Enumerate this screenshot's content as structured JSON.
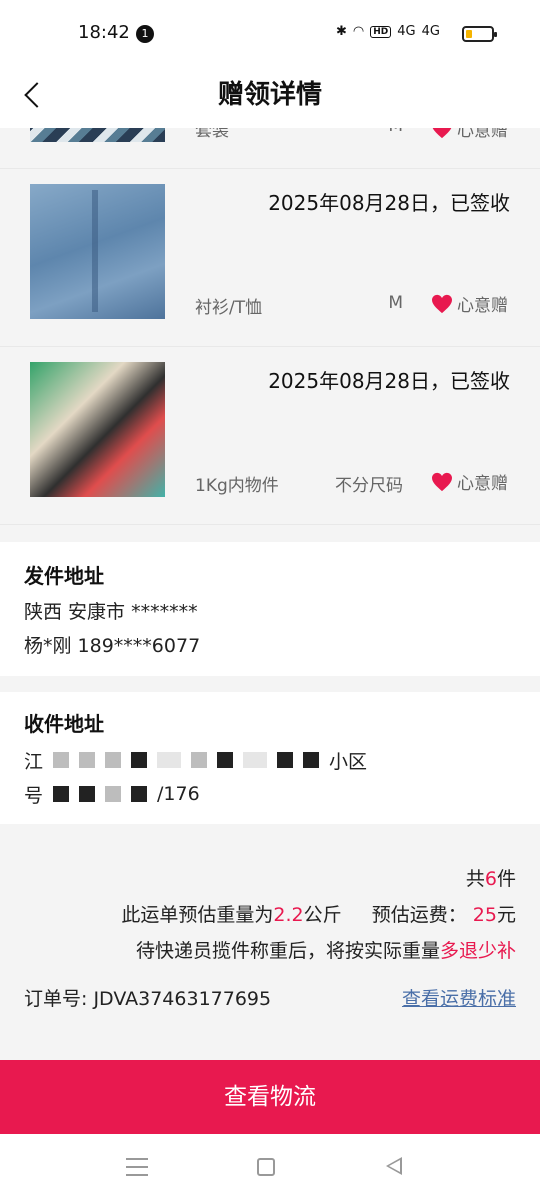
{
  "status_bar": {
    "time": "18:42",
    "notification_count": "1",
    "hd_label": "HD",
    "signal_label_1": "4G",
    "signal_label_2": "4G"
  },
  "header": {
    "title": "赠领详情"
  },
  "items": [
    {
      "category": "套装",
      "size": "M",
      "tag": "心意赠"
    },
    {
      "date": "2025年08月28日，已签收",
      "category": "衬衫/T恤",
      "size": "M",
      "tag": "心意赠"
    },
    {
      "date": "2025年08月28日，已签收",
      "category": "1Kg内物件",
      "size": "不分尺码",
      "tag": "心意赠"
    }
  ],
  "sender": {
    "heading": "发件地址",
    "address": "陕西 安康市 *******",
    "contact": "杨*刚 189****6077"
  },
  "receiver": {
    "heading": "收件地址",
    "address_start": "江",
    "address_end": "小区",
    "line2_start": "号",
    "line2_end": "/176"
  },
  "summary": {
    "count_prefix": "共",
    "count": "6",
    "count_suffix": "件",
    "weight_prefix": "此运单预估重量为",
    "weight": "2.2",
    "weight_unit": "公斤",
    "fee_label": "预估运费：",
    "fee": "25",
    "fee_unit": "元",
    "note_prefix": "待快递员揽件称重后，将按实际重量",
    "note_highlight": "多退少补",
    "order_label": "订单号:",
    "order_number": "JDVA37463177695",
    "fee_standard_link": "查看运费标准"
  },
  "cta": {
    "label": "查看物流"
  },
  "colors": {
    "accent": "#e8194f",
    "link": "#4a6fa8",
    "background": "#f4f4f4"
  },
  "icons": [
    "back-arrow-icon",
    "heart-icon",
    "bluetooth-icon",
    "wifi-icon",
    "battery-icon",
    "menu-icon",
    "home-icon",
    "back-triangle-icon"
  ]
}
